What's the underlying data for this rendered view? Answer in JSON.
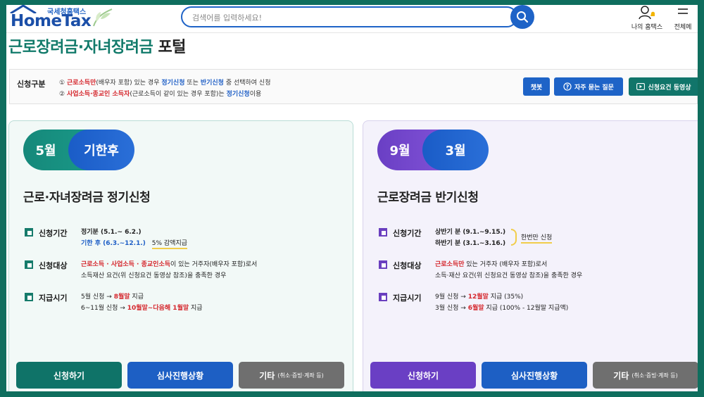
{
  "header": {
    "logo_sub": "국세청홈택스",
    "logo_main": "HomeTax",
    "search_placeholder": "검색어를 입력하세요!",
    "my_hometax": "나의 홈택스",
    "all_menu": "전체메"
  },
  "page_title": {
    "green": "근로장려금·자녀장려금",
    "dark": "포털"
  },
  "info": {
    "label": "신청구분",
    "line1": {
      "num": "①",
      "red": "근로소득만",
      "t1": "(배우자 포함) 있는 경우",
      "blue1": "정기신청",
      "t2": "또는",
      "blue2": "반기신청",
      "t3": "중 선택하여 신청"
    },
    "line2": {
      "num": "②",
      "red": "사업소득·종교인 소득자",
      "t1": "(근로소득이 같이 있는 경우 포함)는",
      "blue": "정기신청",
      "t2": "이용"
    },
    "buttons": {
      "chatbot": "챗봇",
      "faq": "자주 묻는 질문",
      "video": "신청요건 동영상"
    }
  },
  "left_card": {
    "pill1": "5월",
    "pill2": "기한후",
    "title": "근로·자녀장려금 정기신청",
    "period": {
      "label": "신청기간",
      "line1": "정기분 (5.1.~ 6.2.)",
      "line2": "기한 후 (6.3.~12.1.)",
      "note": "5% 감액지급"
    },
    "target": {
      "label": "신청대상",
      "red": "근로소득 · 사업소득 · 종교인소득",
      "t1": "이 있는 거주자(배우자 포함)로서",
      "line2": "소득재산 요건(위 신청요건 동영상 참조)을 충족한 경우"
    },
    "payment": {
      "label": "지급시기",
      "l1a": "5월 신청 →",
      "l1red": "8월말",
      "l1b": "지급",
      "l2a": "6~11월 신청 →",
      "l2red": "10월말~다음해 1월말",
      "l2b": "지급"
    },
    "buttons": {
      "apply": "신청하기",
      "status": "심사진행상황",
      "etc": "기타",
      "etc_sub": "(취소·증빙·계좌 등)"
    }
  },
  "right_card": {
    "pill1": "9월",
    "pill2": "3월",
    "title": "근로장려금 반기신청",
    "period": {
      "label": "신청기간",
      "line1": "상반기 분 (9.1.~9.15.)",
      "line2": "하반기 분 (3.1.~3.16.)",
      "note": "한번만 신청"
    },
    "target": {
      "label": "신청대상",
      "red": "근로소득만",
      "t1": "있는 거주자 (배우자 포함)로서",
      "line2": "소득·재산 요건(위 신청요건 동영상 참조)을 충족한 경우"
    },
    "payment": {
      "label": "지급시기",
      "l1a": "9월 신청 →",
      "l1red": "12월말",
      "l1b": "지급 (35%)",
      "l2a": "3월 신청 →",
      "l2red": "6월말",
      "l2b": "지급 (100% - 12월말 지급액)"
    },
    "buttons": {
      "apply": "신청하기",
      "status": "심사진행상황",
      "etc": "기타",
      "etc_sub": "(취소·증빙·계좌 등)"
    }
  },
  "colors": {
    "brand_blue": "#1e63c7",
    "teal": "#11756a",
    "purple": "#6a3fbf",
    "red": "#d5272d",
    "gray_button": "#6f6f6f"
  }
}
